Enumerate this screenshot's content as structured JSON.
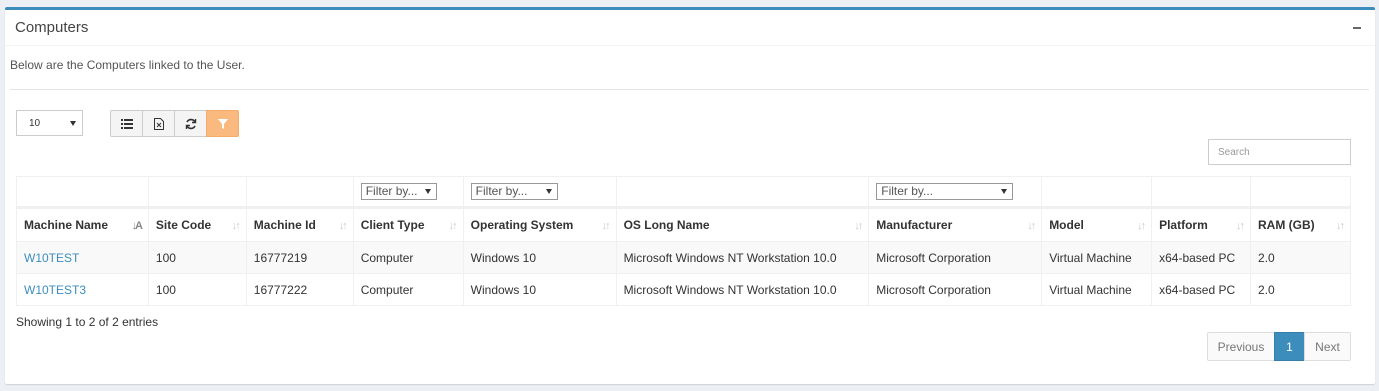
{
  "panel": {
    "title": "Computers",
    "description": "Below are the Computers linked to the User."
  },
  "controls": {
    "page_length": "10",
    "search_placeholder": "Search",
    "toolbar": {
      "list_icon": "list-icon",
      "export_icon": "excel-export-icon",
      "refresh_icon": "refresh-icon",
      "filter_icon": "filter-icon"
    }
  },
  "filters": {
    "client_type": "Filter by...",
    "operating_system": "Filter by...",
    "manufacturer": "Filter by..."
  },
  "table": {
    "columns": [
      "Machine Name",
      "Site Code",
      "Machine Id",
      "Client Type",
      "Operating System",
      "OS Long Name",
      "Manufacturer",
      "Model",
      "Platform",
      "RAM (GB)"
    ],
    "rows": [
      [
        "W10TEST",
        "100",
        "16777219",
        "Computer",
        "Windows 10",
        "Microsoft Windows NT Workstation 10.0",
        "Microsoft Corporation",
        "Virtual Machine",
        "x64-based PC",
        "2.0"
      ],
      [
        "W10TEST3",
        "100",
        "16777222",
        "Computer",
        "Windows 10",
        "Microsoft Windows NT Workstation 10.0",
        "Microsoft Corporation",
        "Virtual Machine",
        "x64-based PC",
        "2.0"
      ]
    ]
  },
  "footer": {
    "info": "Showing 1 to 2 of 2 entries"
  },
  "pagination": {
    "previous": "Previous",
    "current": "1",
    "next": "Next"
  },
  "colors": {
    "accent": "#3c8dbc",
    "filter_button": "#f9b97f"
  }
}
